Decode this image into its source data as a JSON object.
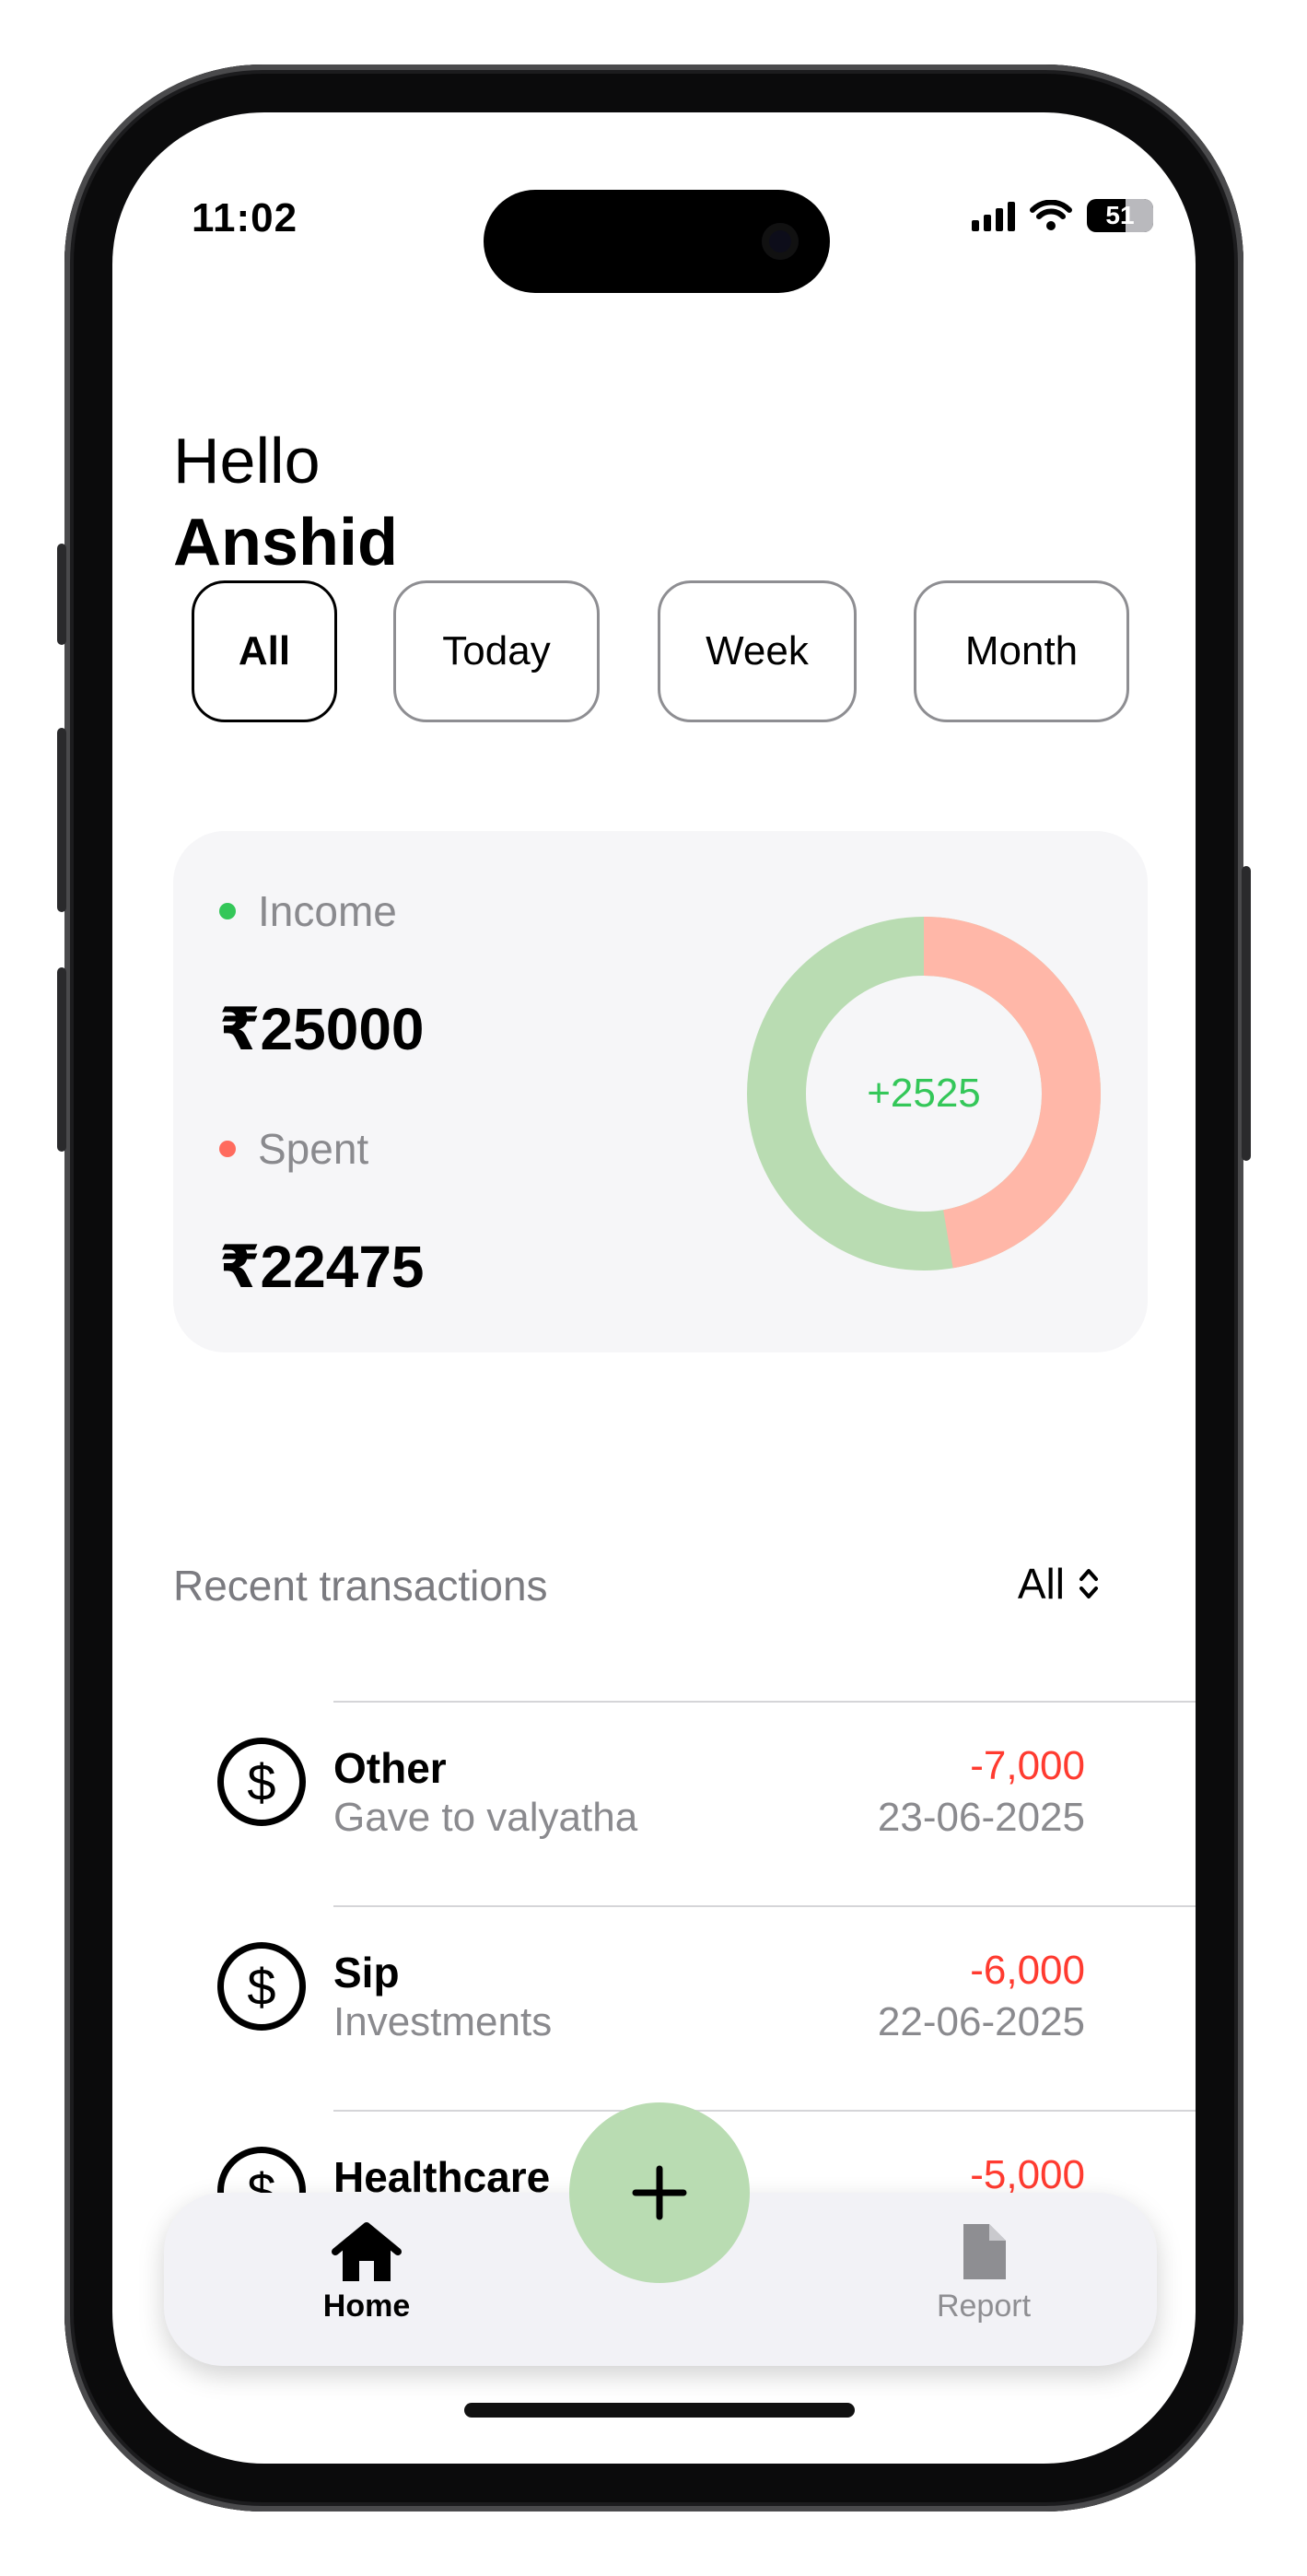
{
  "status_bar": {
    "time": "11:02",
    "battery": "51"
  },
  "greeting": {
    "hello": "Hello",
    "name": "Anshid"
  },
  "filters": [
    {
      "label": "All",
      "active": true
    },
    {
      "label": "Today",
      "active": false
    },
    {
      "label": "Week",
      "active": false
    },
    {
      "label": "Month",
      "active": false
    }
  ],
  "summary": {
    "income_label": "Income",
    "income_amount": "₹25000",
    "spent_label": "Spent",
    "spent_amount": "₹22475",
    "net": "+2525",
    "income_value": 25000,
    "spent_value": 22475,
    "colors": {
      "income": "#34c759",
      "spent": "#ff6b5e",
      "income_ring": "#b9dcb2",
      "spent_ring": "#ffb7a8"
    }
  },
  "recent": {
    "title": "Recent transactions",
    "filter": "All",
    "items": [
      {
        "title": "Other",
        "subtitle": "Gave to valyatha",
        "amount": "-7,000",
        "date": "23-06-2025",
        "icon": "dollar-circle-icon"
      },
      {
        "title": "Sip",
        "subtitle": "Investments",
        "amount": "-6,000",
        "date": "22-06-2025",
        "icon": "dollar-circle-icon"
      },
      {
        "title": "Healthcare",
        "subtitle": "",
        "amount": "-5,000",
        "date": "",
        "icon": "dollar-circle-icon"
      }
    ]
  },
  "tabbar": {
    "home_label": "Home",
    "report_label": "Report"
  }
}
